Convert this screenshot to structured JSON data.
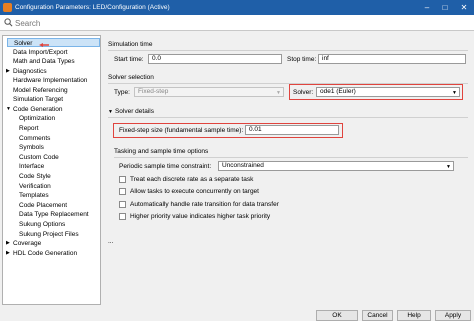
{
  "window": {
    "title": "Configuration Parameters: LED/Configuration (Active)"
  },
  "search": {
    "placeholder": "Search"
  },
  "tree": [
    {
      "label": "Solver",
      "selected": true,
      "arrow": ""
    },
    {
      "label": "Data Import/Export",
      "arrow": ""
    },
    {
      "label": "Math and Data Types",
      "arrow": ""
    },
    {
      "label": "Diagnostics",
      "arrow": "▶"
    },
    {
      "label": "Hardware Implementation",
      "arrow": ""
    },
    {
      "label": "Model Referencing",
      "arrow": ""
    },
    {
      "label": "Simulation Target",
      "arrow": ""
    },
    {
      "label": "Code Generation",
      "arrow": "▼"
    },
    {
      "label": "Optimization",
      "arrow": ""
    },
    {
      "label": "Report",
      "arrow": ""
    },
    {
      "label": "Comments",
      "arrow": ""
    },
    {
      "label": "Symbols",
      "arrow": ""
    },
    {
      "label": "Custom Code",
      "arrow": ""
    },
    {
      "label": "Interface",
      "arrow": ""
    },
    {
      "label": "Code Style",
      "arrow": ""
    },
    {
      "label": "Verification",
      "arrow": ""
    },
    {
      "label": "Templates",
      "arrow": ""
    },
    {
      "label": "Code Placement",
      "arrow": ""
    },
    {
      "label": "Data Type Replacement",
      "arrow": ""
    },
    {
      "label": "Sukung Options",
      "arrow": ""
    },
    {
      "label": "Sukung Project Files",
      "arrow": ""
    },
    {
      "label": "Coverage",
      "arrow": "▶"
    },
    {
      "label": "HDL Code Generation",
      "arrow": "▶"
    }
  ],
  "simulation_time": {
    "header": "Simulation time",
    "start_label": "Start time:",
    "start_value": "0.0",
    "stop_label": "Stop time:",
    "stop_value": "inf"
  },
  "solver_selection": {
    "header": "Solver selection",
    "type_label": "Type:",
    "type_value": "Fixed-step",
    "solver_label": "Solver:",
    "solver_value": "ode1 (Euler)"
  },
  "solver_details": {
    "header": "Solver details",
    "fixed_step_label": "Fixed-step size (fundamental sample time):",
    "fixed_step_value": "0.01"
  },
  "tasking": {
    "header": "Tasking and sample time options",
    "periodic_label": "Periodic sample time constraint:",
    "periodic_value": "Unconstrained",
    "options": [
      "Treat each discrete rate as a separate task",
      "Allow tasks to execute concurrently on target",
      "Automatically handle rate transition for data transfer",
      "Higher priority value indicates higher task priority"
    ]
  },
  "ellipsis": "...",
  "buttons": {
    "ok": "OK",
    "cancel": "Cancel",
    "help": "Help",
    "apply": "Apply"
  },
  "colors": {
    "titlebar": "#1f5fa8",
    "highlight": "#e0443e",
    "selection": "#cce3f7"
  }
}
